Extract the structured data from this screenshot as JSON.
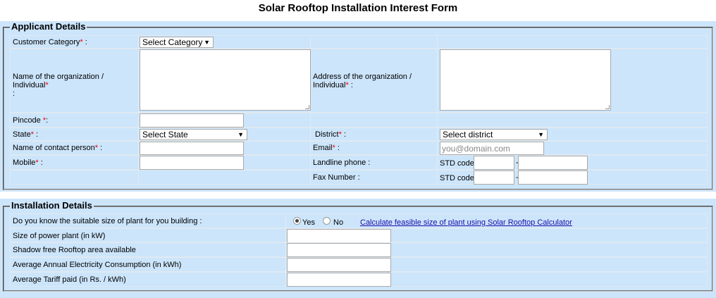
{
  "title": "Solar Rooftop Installation Interest Form",
  "applicant": {
    "legend": "Applicant Details",
    "customer_category_label": "Customer Category",
    "customer_category_value": "Select Category",
    "org_name_label_1": "Name of the organization / Individual",
    "org_name_label_2": ":",
    "address_label_1": "Address of the organization /",
    "address_label_2": "Individual",
    "pincode_label": "Pincode ",
    "state_label": "State",
    "state_value": "Select State",
    "district_label": "District",
    "district_value": "Select district",
    "contact_label": "Name of contact person",
    "email_label": "Email",
    "email_placeholder": "you@domain.com",
    "mobile_label": "Mobile",
    "landline_label": "Landline phone :",
    "fax_label": "Fax Number :",
    "std_code_label": "STD code",
    "dash": "-",
    "required_mark": "*",
    "colon": " :",
    "colon_tight": ":"
  },
  "installation": {
    "legend": "Installation Details",
    "know_size_label": "Do you know the suitable size of plant for you building :",
    "yes_label": "Yes",
    "no_label": "No",
    "yes_selected": true,
    "calculator_link": "Calculate feasible size of plant using Solar Rooftop Calculator",
    "plant_size_label": "Size of power plant (in kW)",
    "shadow_area_label": "Shadow free Rooftop area available",
    "consumption_label": "Average Annual Electricity Consumption (in kWh)",
    "tariff_label": "Average Tariff paid (in Rs. / kWh)"
  }
}
